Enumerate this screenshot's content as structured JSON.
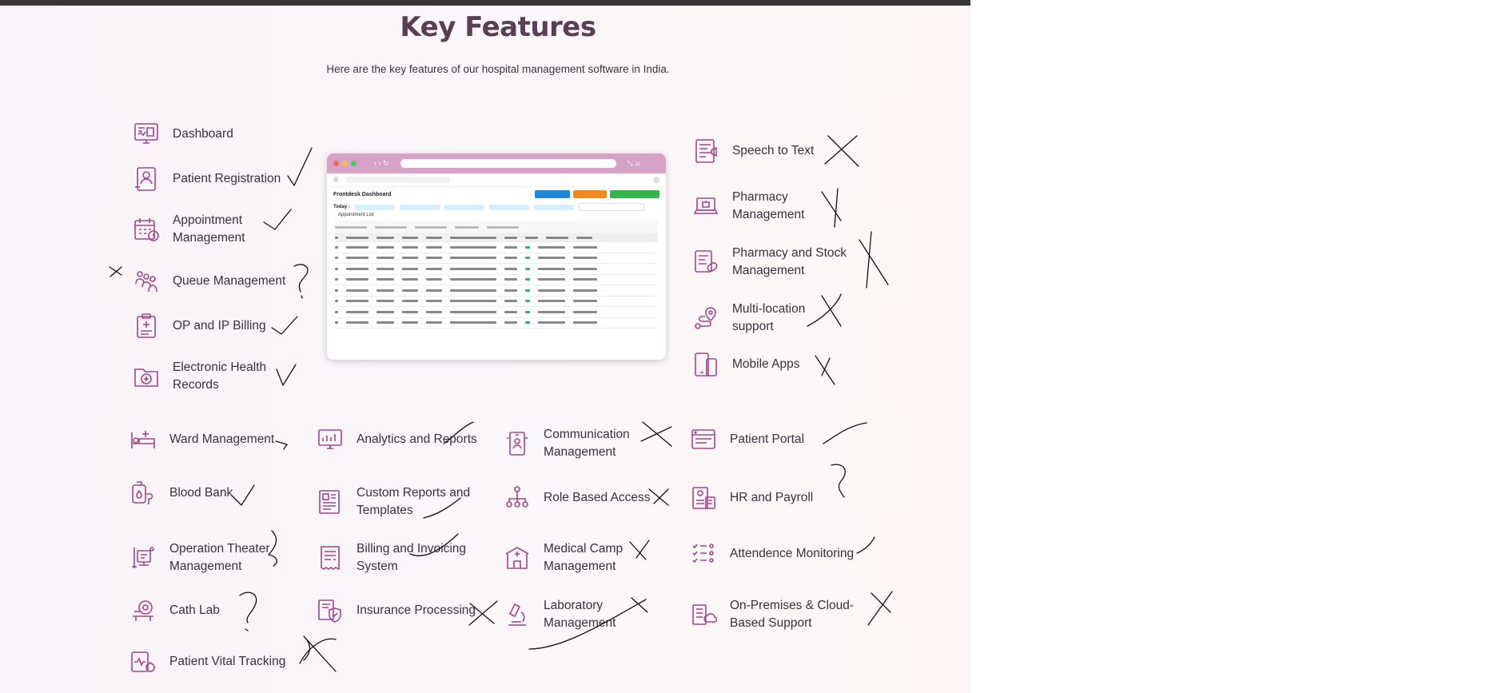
{
  "header": {
    "title": "Key Features",
    "subtitle": "Here are the key features of our hospital management software in India."
  },
  "dashboard_preview": {
    "heading": "Frontdesk Dashboard",
    "icon": "frontdesk-dashboard-screenshot",
    "appointment_tab": "Appointment List",
    "today_label": "Today :"
  },
  "features": {
    "left": [
      {
        "label": "Dashboard",
        "icon": "dashboard-icon"
      },
      {
        "label": "Patient Registration",
        "icon": "patient-registration-icon"
      },
      {
        "label": "Appointment\nManagement",
        "icon": "calendar-icon"
      },
      {
        "label": "Queue Management",
        "icon": "queue-icon"
      },
      {
        "label": "OP and IP Billing",
        "icon": "billing-clipboard-icon"
      },
      {
        "label": "Electronic Health\nRecords",
        "icon": "health-records-folder-icon"
      }
    ],
    "right": [
      {
        "label": "Speech to Text",
        "icon": "speech-to-text-icon"
      },
      {
        "label": "Pharmacy\nManagement",
        "icon": "pharmacy-laptop-icon"
      },
      {
        "label": "Pharmacy and Stock\nManagement",
        "icon": "pharmacy-stock-icon"
      },
      {
        "label": "Multi-location\nsupport",
        "icon": "multi-location-icon"
      },
      {
        "label": "Mobile Apps",
        "icon": "mobile-apps-icon"
      }
    ],
    "col1": [
      {
        "label": "Ward Management",
        "icon": "hospital-bed-icon"
      },
      {
        "label": "Blood Bank",
        "icon": "blood-bag-icon"
      },
      {
        "label": "Operation Theater\nManagement",
        "icon": "operation-theater-icon"
      },
      {
        "label": "Cath Lab",
        "icon": "cath-lab-icon"
      },
      {
        "label": "Patient Vital Tracking",
        "icon": "vital-tracking-icon"
      }
    ],
    "col2": [
      {
        "label": "Analytics and Reports",
        "icon": "analytics-monitor-icon"
      },
      {
        "label": "Custom Reports and\nTemplates",
        "icon": "report-templates-icon"
      },
      {
        "label": "Billing and Invoicing\nSystem",
        "icon": "invoice-icon"
      },
      {
        "label": "Insurance Processing",
        "icon": "insurance-shield-icon"
      }
    ],
    "col3": [
      {
        "label": "Communication\nManagement",
        "icon": "communication-phone-icon"
      },
      {
        "label": "Role Based Access",
        "icon": "role-hierarchy-icon"
      },
      {
        "label": "Medical Camp\nManagement",
        "icon": "medical-camp-icon"
      },
      {
        "label": "Laboratory\nManagement",
        "icon": "microscope-icon"
      }
    ],
    "col4": [
      {
        "label": "Patient Portal",
        "icon": "patient-portal-icon"
      },
      {
        "label": "HR and Payroll",
        "icon": "hr-payroll-icon"
      },
      {
        "label": "Attendence Monitoring",
        "icon": "attendance-checklist-icon"
      },
      {
        "label": "On-Premises & Cloud-\nBased Support",
        "icon": "cloud-server-icon"
      }
    ]
  },
  "colors": {
    "accent": "#a1468f",
    "title": "#5a3e55",
    "text": "#3b3040",
    "annotation_ink": "#111111"
  }
}
